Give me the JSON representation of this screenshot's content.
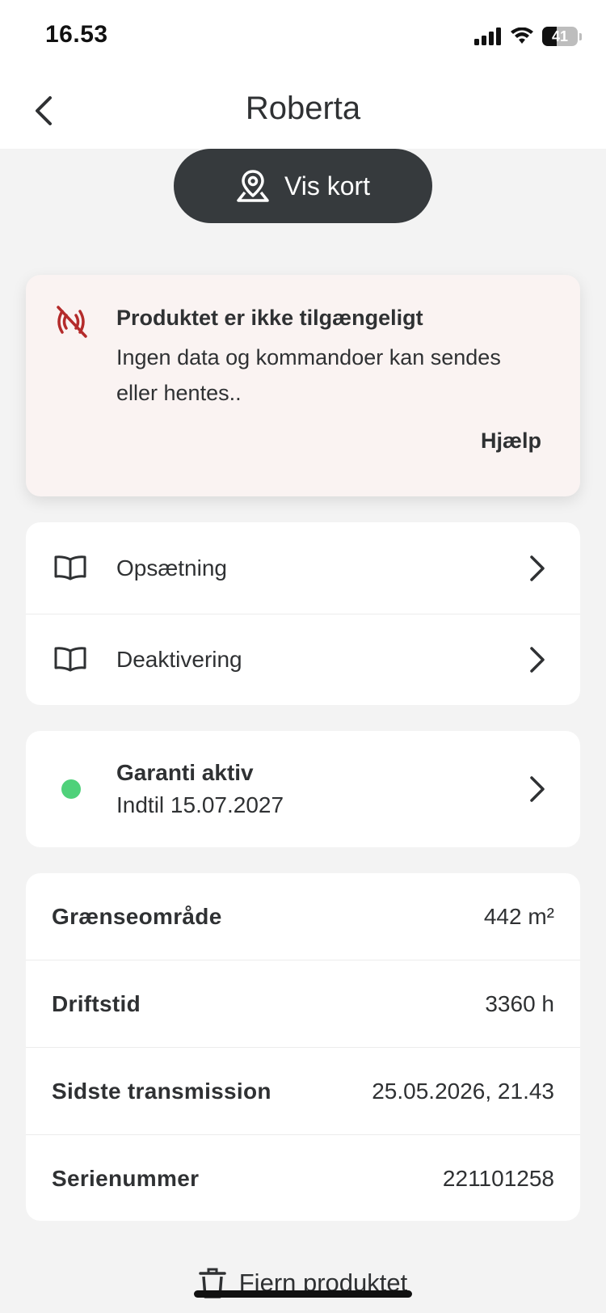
{
  "status_bar": {
    "time": "16.53",
    "battery": "41"
  },
  "header": {
    "title": "Roberta"
  },
  "map_button": {
    "label": "Vis kort"
  },
  "alert": {
    "title": "Produktet er ikke tilgængeligt",
    "message": "Ingen data og kommandoer kan sendes eller hentes..",
    "help_label": "Hjælp",
    "accent_color": "#b42b2b"
  },
  "nav_items": [
    {
      "label": "Opsætning"
    },
    {
      "label": "Deaktivering"
    }
  ],
  "warranty": {
    "title": "Garanti aktiv",
    "subtitle": "Indtil 15.07.2027",
    "status_color": "#4fd17a"
  },
  "info": [
    {
      "key": "Grænseområde",
      "value": "442 m²"
    },
    {
      "key": "Driftstid",
      "value": "3360 h"
    },
    {
      "key": "Sidste transmission",
      "value": "25.05.2026, 21.43"
    },
    {
      "key": "Serienummer",
      "value": "221101258"
    }
  ],
  "remove_button": {
    "label": "Fjern produktet"
  }
}
